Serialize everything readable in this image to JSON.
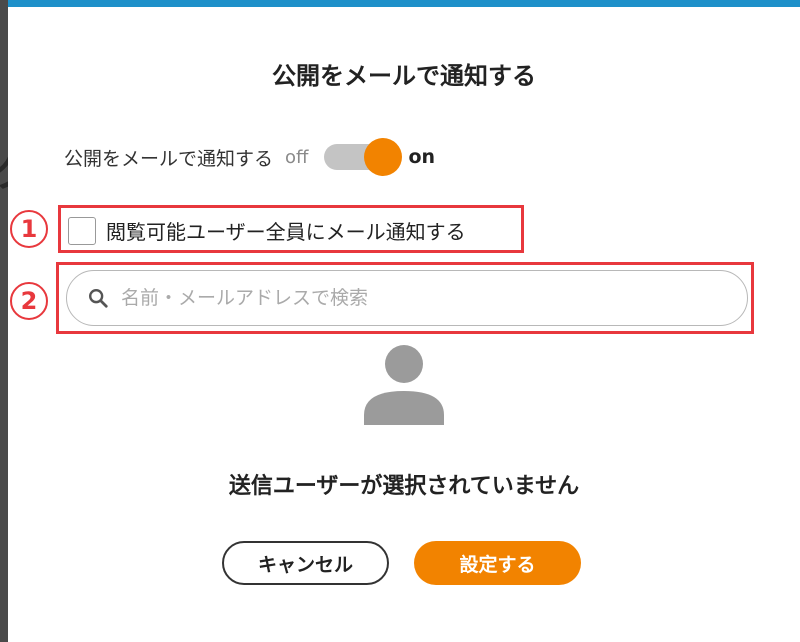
{
  "backdrop": {
    "glyph": "ク"
  },
  "dialog": {
    "title": "公開をメールで通知する",
    "toggle": {
      "label": "公開をメールで通知する",
      "off_label": "off",
      "on_label": "on",
      "state": "on"
    },
    "annotations": [
      "1",
      "2"
    ],
    "notify_all_checkbox": {
      "label": "閲覧可能ユーザー全員にメール通知する",
      "checked": false
    },
    "search": {
      "placeholder": "名前・メールアドレスで検索",
      "value": ""
    },
    "empty_state": {
      "text": "送信ユーザーが選択されていません"
    },
    "buttons": {
      "cancel": "キャンセル",
      "submit": "設定する"
    }
  },
  "colors": {
    "accent": "#f28300",
    "annotation": "#e8383d",
    "top_bar": "#1e90c9",
    "toggle_track": "#c4c4c4"
  }
}
